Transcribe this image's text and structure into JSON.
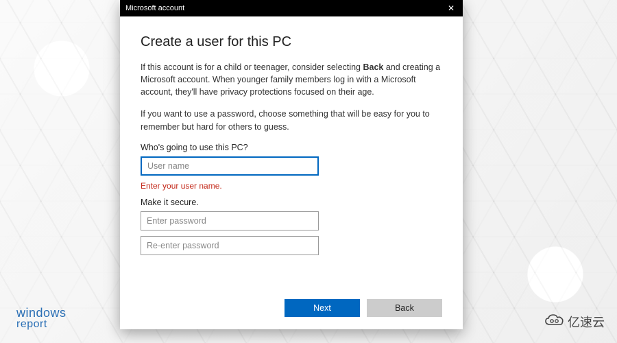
{
  "titlebar": {
    "title": "Microsoft account",
    "close": "✕"
  },
  "dialog": {
    "heading": "Create a user for this PC",
    "para1_a": "If this account is for a child or teenager, consider selecting ",
    "para1_bold": "Back",
    "para1_b": " and creating a Microsoft account. When younger family members log in with a Microsoft account, they'll have privacy protections focused on their age.",
    "para2": "If you want to use a password, choose something that will be easy for you to remember but hard for others to guess.",
    "section1_label": "Who's going to use this PC?",
    "username_placeholder": "User name",
    "username_value": "",
    "error_text": "Enter your user name.",
    "section2_label": "Make it secure.",
    "password_placeholder": "Enter password",
    "password_value": "",
    "password2_placeholder": "Re-enter password",
    "password2_value": "",
    "next_label": "Next",
    "back_label": "Back"
  },
  "watermarks": {
    "left_line1": "windows",
    "left_line2": "report",
    "right_text": "亿速云"
  },
  "colors": {
    "primary": "#0067c0",
    "error": "#c42b1c"
  }
}
